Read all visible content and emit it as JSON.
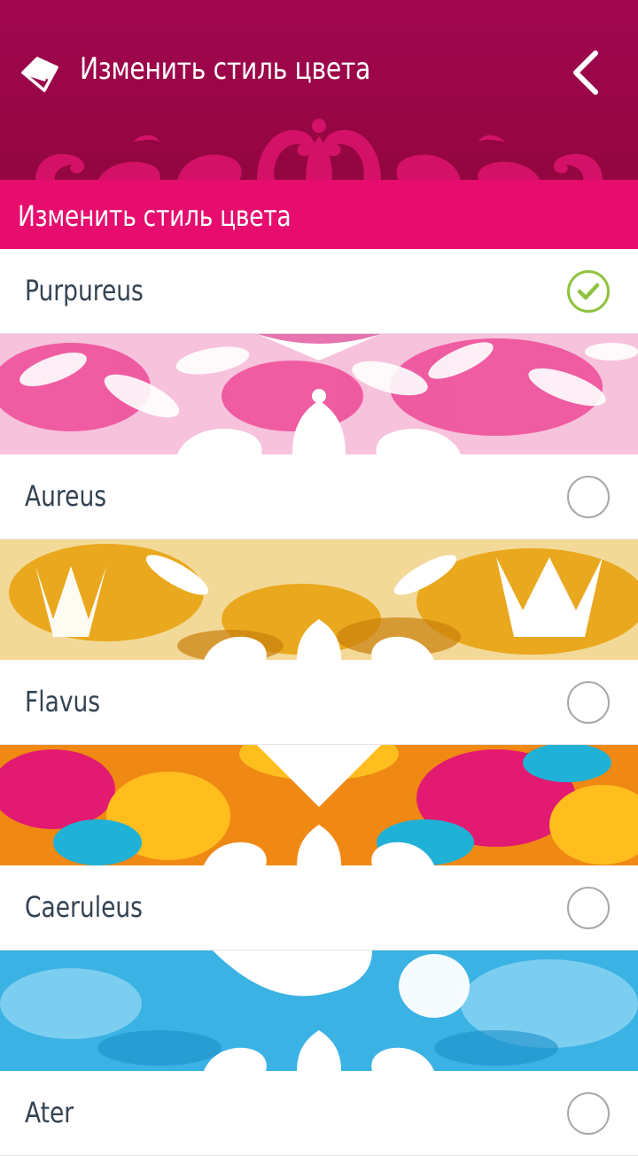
{
  "header": {
    "title": "Изменить стиль цвета",
    "icon": "eraser-icon",
    "back_icon": "chevron-left-icon",
    "color_top": "#a1064f"
  },
  "section": {
    "title": "Изменить стиль цвета",
    "color": "#e60d6e"
  },
  "options": [
    {
      "label": "Purpureus",
      "selected": true,
      "colors": [
        "#ffffff",
        "#f8a8cd",
        "#ee4a97",
        "#d4187a"
      ]
    },
    {
      "label": "Aureus",
      "selected": false,
      "colors": [
        "#ffffff",
        "#f5d36a",
        "#e9a81d",
        "#c97f0c"
      ]
    },
    {
      "label": "Flavus",
      "selected": false,
      "colors": [
        "#ffbe1e",
        "#f08814",
        "#e21a72",
        "#1fb1d6"
      ]
    },
    {
      "label": "Caeruleus",
      "selected": false,
      "colors": [
        "#ffffff",
        "#8dd4f2",
        "#3bb2e4",
        "#1d8fc9"
      ]
    },
    {
      "label": "Ater",
      "selected": false,
      "colors": []
    }
  ],
  "check_color": "#8fc33f"
}
